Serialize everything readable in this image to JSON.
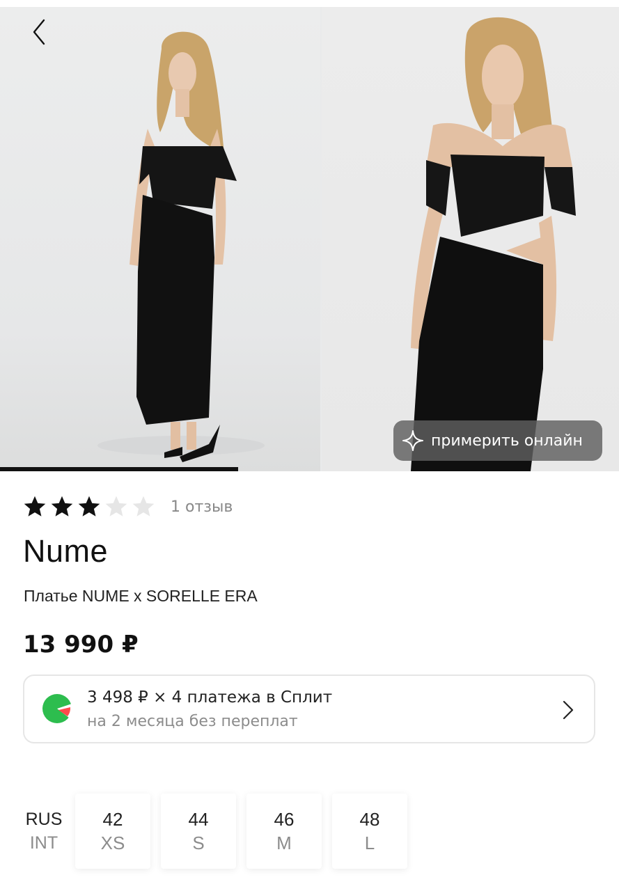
{
  "gallery": {
    "photos": [
      "photo-full-length",
      "photo-close-up"
    ],
    "active_index": 0,
    "progress_fraction": 0.385,
    "try_on_label": "примерить онлайн",
    "back_icon": "chevron-left-icon",
    "try_on_icon": "sparkle-icon"
  },
  "rating": {
    "stars_filled": 3,
    "stars_total": 5,
    "reviews_label": "1 отзыв",
    "star_color": "#111111",
    "star_empty_color": "#e6e6e6"
  },
  "product": {
    "brand": "Nume",
    "name": "Платье NUME x SORELLE ERA",
    "price": "13 990 ₽"
  },
  "split": {
    "line1": "3 498 ₽ × 4 платежа в Сплит",
    "line2": "на 2 месяца без переплат",
    "logo_icon": "split-logo-icon",
    "logo_color": "#2dbd4e"
  },
  "sizes": {
    "label_rus": "RUS",
    "label_int": "INT",
    "items": [
      {
        "rus": "42",
        "int": "XS"
      },
      {
        "rus": "44",
        "int": "S"
      },
      {
        "rus": "46",
        "int": "M"
      },
      {
        "rus": "48",
        "int": "L"
      }
    ]
  }
}
